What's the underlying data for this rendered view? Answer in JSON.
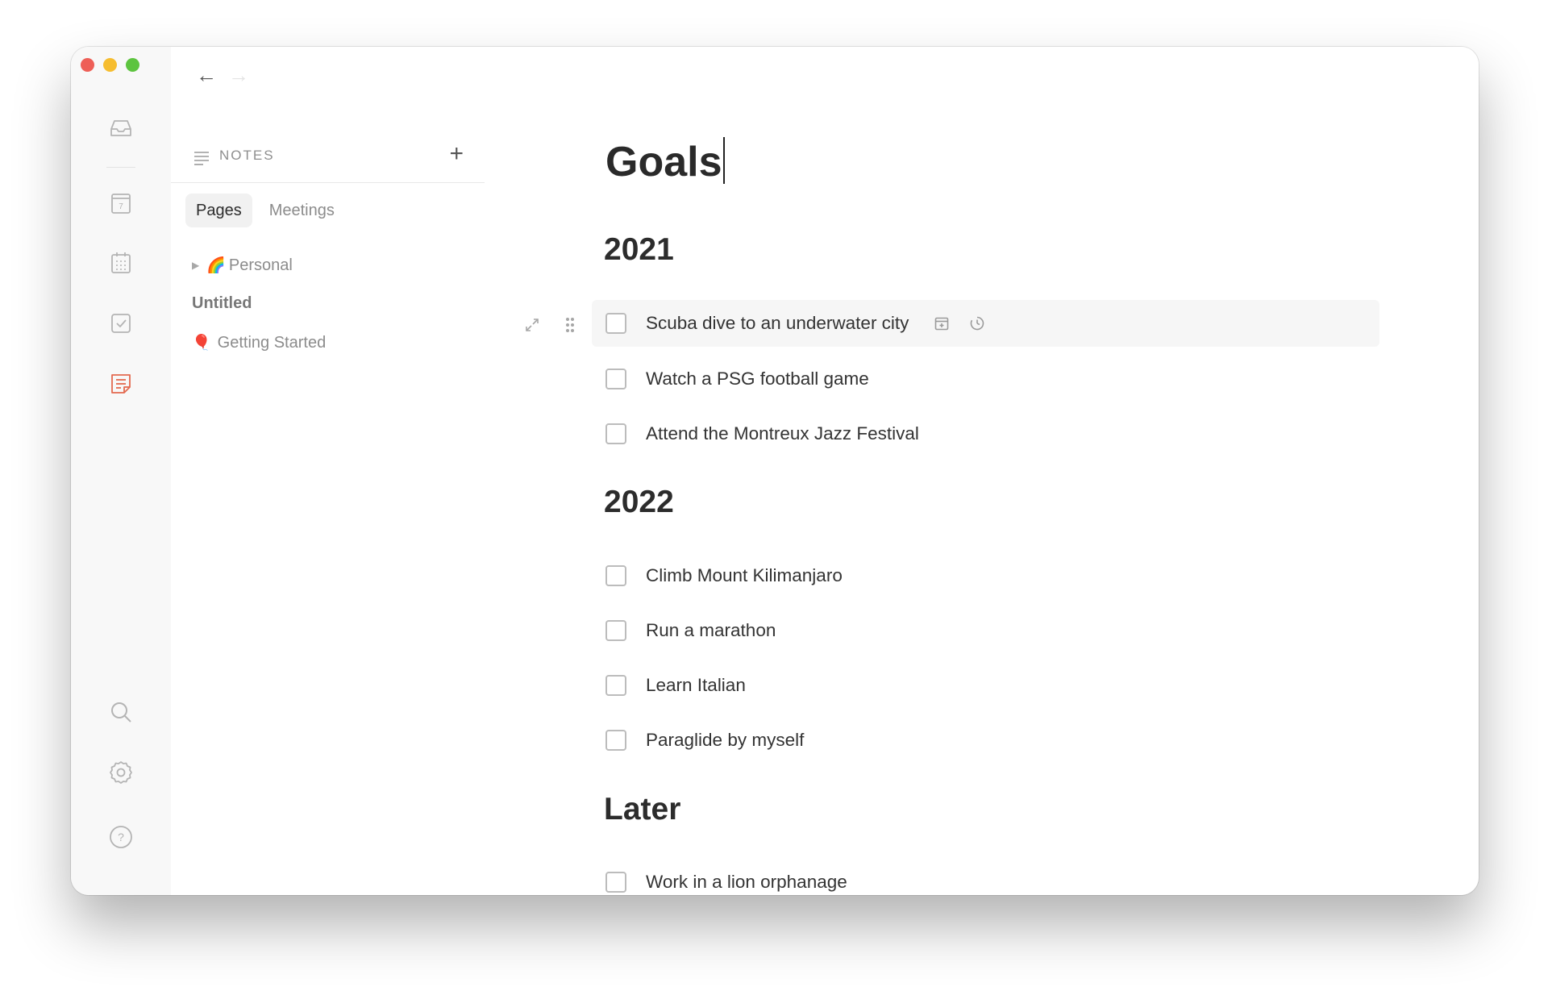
{
  "notes": {
    "header_label": "NOTES",
    "tabs": [
      "Pages",
      "Meetings"
    ],
    "pages": [
      {
        "label": "Personal",
        "emoji": "🌈"
      },
      {
        "label": "Untitled"
      },
      {
        "label": "Getting Started",
        "emoji": "🎈"
      }
    ]
  },
  "calendar_day": "7",
  "document": {
    "title": "Goals",
    "sections": [
      {
        "heading": "2021",
        "tasks": [
          "Scuba dive to an underwater city",
          "Watch a PSG football game",
          "Attend the Montreux Jazz Festival"
        ]
      },
      {
        "heading": "2022",
        "tasks": [
          "Climb Mount Kilimanjaro",
          "Run a marathon",
          "Learn Italian",
          "Paraglide by myself"
        ]
      },
      {
        "heading": "Later",
        "tasks": [
          "Work in a lion orphanage"
        ]
      }
    ]
  },
  "colors": {
    "accent": "#e3694f",
    "traffic_red": "#ee5f57",
    "traffic_yellow": "#f6bd2f",
    "traffic_green": "#5dc43f"
  }
}
